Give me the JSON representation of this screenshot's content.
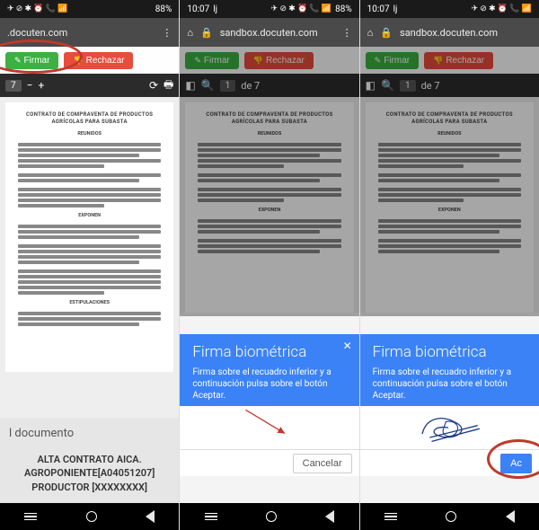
{
  "status": {
    "time": "10:07",
    "carrier": "lj",
    "battery": "88%",
    "icons": "✈ ⊘ ✱ ⏰ 📞 📶"
  },
  "browser": {
    "url": "sandbox.docuten.com",
    "url_short": ".docuten.com"
  },
  "actions": {
    "sign": "Firmar",
    "reject": "Rechazar"
  },
  "toolbar": {
    "page_current": "1",
    "page_total": "de 7",
    "page_total_short": "7"
  },
  "document": {
    "title": "CONTRATO DE COMPRAVENTA DE PRODUCTOS AGRÍCOLAS PARA SUBASTA",
    "sec_reunidos": "REUNIDOS",
    "sec_exponen": "EXPONEN",
    "sec_estipulaciones": "ESTIPULACIONES"
  },
  "docinfo": {
    "heading": "l documento",
    "line1": "ALTA CONTRATO AICA.",
    "line2": "AGROPONIENTE[A04051207]",
    "line3": "PRODUCTOR [XXXXXXXX]"
  },
  "modal": {
    "title": "Firma biométrica",
    "body": "Firma sobre el recuadro inferior y a continuación pulsa sobre el botón Aceptar.",
    "body_cut": "Firma sobre el recuadro inferior y a continuación pulsa sobre el botón Aceptar.",
    "cancel": "Cancelar",
    "accept": "Aceptar",
    "accept_cut": "Ac"
  }
}
